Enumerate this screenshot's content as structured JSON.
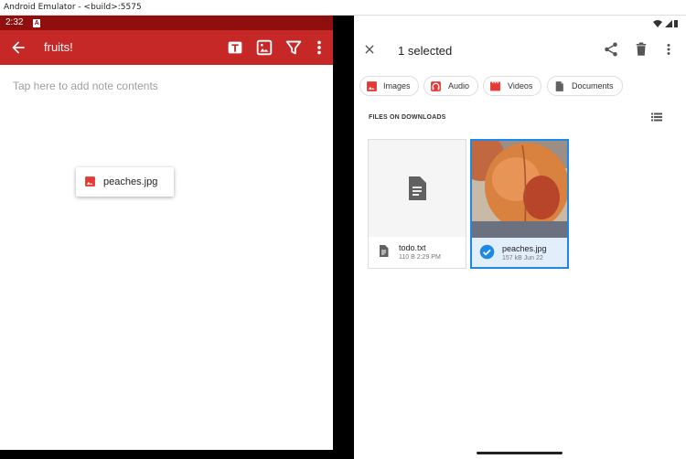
{
  "window": {
    "title": "Android Emulator - <build>:5575"
  },
  "left": {
    "status": {
      "time": "2:32",
      "icon_letter": "A"
    },
    "appbar": {
      "title": "fruits!",
      "icons": [
        "back-arrow-icon",
        "text-format-icon",
        "image-icon",
        "filter-icon",
        "more-vert-icon"
      ]
    },
    "note_placeholder": "Tap here to add note contents",
    "dragged_file": {
      "label": "peaches.jpg",
      "icon": "image-icon"
    }
  },
  "right": {
    "header": {
      "title": "1 selected",
      "icons": [
        "close-icon",
        "share-icon",
        "delete-icon",
        "more-vert-icon"
      ]
    },
    "chips": [
      {
        "label": "Images",
        "icon": "image-icon",
        "color": "#e53935"
      },
      {
        "label": "Audio",
        "icon": "headphones-icon",
        "color": "#e53935"
      },
      {
        "label": "Videos",
        "icon": "movie-icon",
        "color": "#e53935"
      },
      {
        "label": "Documents",
        "icon": "document-icon",
        "color": "#616161"
      }
    ],
    "section_label": "FILES ON DOWNLOADS",
    "files": [
      {
        "name": "todo.txt",
        "meta": "110 B 2:29 PM",
        "selected": false
      },
      {
        "name": "peaches.jpg",
        "meta": "157 kB Jun 22",
        "selected": true
      }
    ]
  },
  "colors": {
    "accent": "#c62828",
    "status": "#8f0f0f",
    "selection": "#1e88e5"
  }
}
